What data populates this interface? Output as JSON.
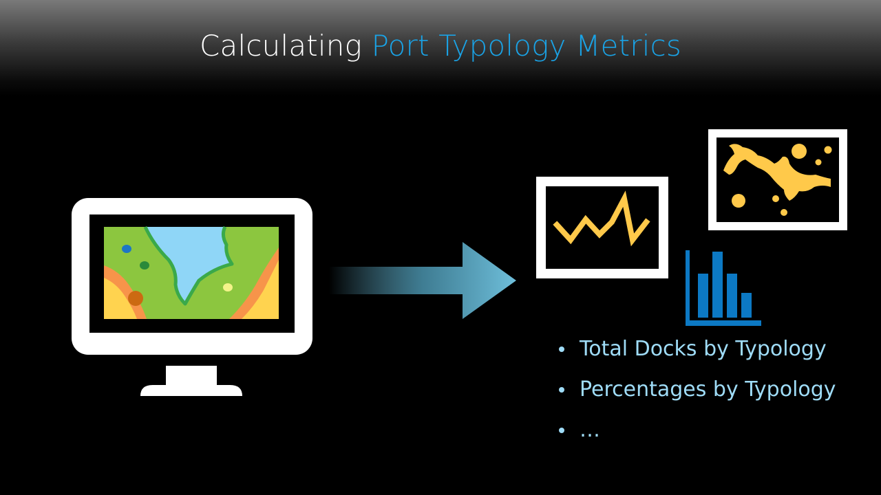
{
  "slide": {
    "title": {
      "lead": "Calculating",
      "accent": "Port Typology Metrics"
    },
    "bullets": [
      "Total Docks by Typology",
      "Percentages by Typology",
      "…"
    ]
  },
  "colors": {
    "background": "#000000",
    "title_text": "#ffffff",
    "title_accent": "#1aa3e6",
    "bullet_text": "#9fdcf7",
    "chart_icon_blue": "#0c79c4",
    "icon_yellow": "#ffc94a",
    "arrow_blue": "#6fbfdb"
  },
  "icons": {
    "monitor": "monitor-map-icon",
    "arrow": "right-arrow-icon",
    "line_chart": "line-chart-icon",
    "map": "raster-map-icon",
    "bar_chart": "bar-chart-icon"
  }
}
